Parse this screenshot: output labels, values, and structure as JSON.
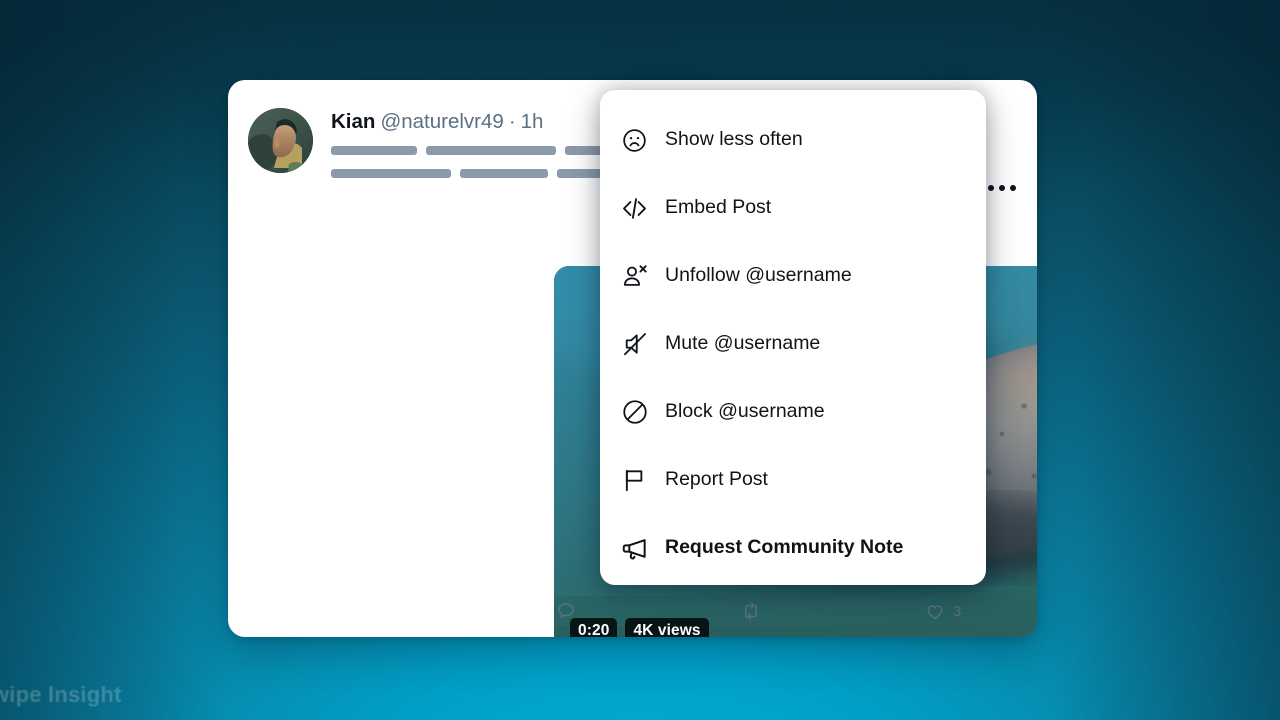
{
  "background": {
    "gradient_top": "#063040",
    "gradient_bottom": "#00b5dd"
  },
  "watermark": {
    "text": "wipe Insight"
  },
  "post": {
    "author": {
      "display_name": "Kian",
      "handle": "@naturelvr49",
      "separator": "·",
      "timestamp": "1h",
      "avatar_icon": "person-avatar-photo"
    },
    "body_placeholder": {
      "note": "skeleton-loading-bars",
      "rows": [
        [
          86,
          130,
          72,
          78,
          112,
          28
        ],
        [
          120,
          88,
          50,
          86,
          92,
          28
        ]
      ]
    },
    "media": {
      "type": "video",
      "alt_description": "underwater manatee",
      "duration_badge": "0:20",
      "views_badge": "4K views"
    },
    "actions": [
      {
        "name": "reply",
        "icon": "comment-icon",
        "count": ""
      },
      {
        "name": "repost",
        "icon": "repost-icon",
        "count": ""
      },
      {
        "name": "like",
        "icon": "heart-icon",
        "count": "3"
      },
      {
        "name": "share",
        "icon": "share-icon",
        "count": ""
      }
    ],
    "more_button": {
      "label": "More",
      "icon": "ellipsis-icon"
    }
  },
  "menu": {
    "items": [
      {
        "id": "show-less-often",
        "label": "Show less often",
        "icon": "frowning-face-icon",
        "emphasis": false
      },
      {
        "id": "embed-post",
        "label": "Embed Post",
        "icon": "code-brackets-icon",
        "emphasis": false
      },
      {
        "id": "unfollow-username",
        "label": "Unfollow @username",
        "icon": "person-remove-icon",
        "emphasis": false
      },
      {
        "id": "mute-username",
        "label": "Mute @username",
        "icon": "mute-icon",
        "emphasis": false
      },
      {
        "id": "block-username",
        "label": "Block @username",
        "icon": "block-icon",
        "emphasis": false
      },
      {
        "id": "report-post",
        "label": "Report Post",
        "icon": "flag-icon",
        "emphasis": false
      },
      {
        "id": "request-community-note",
        "label": "Request Community Note",
        "icon": "megaphone-icon",
        "emphasis": true
      }
    ]
  }
}
